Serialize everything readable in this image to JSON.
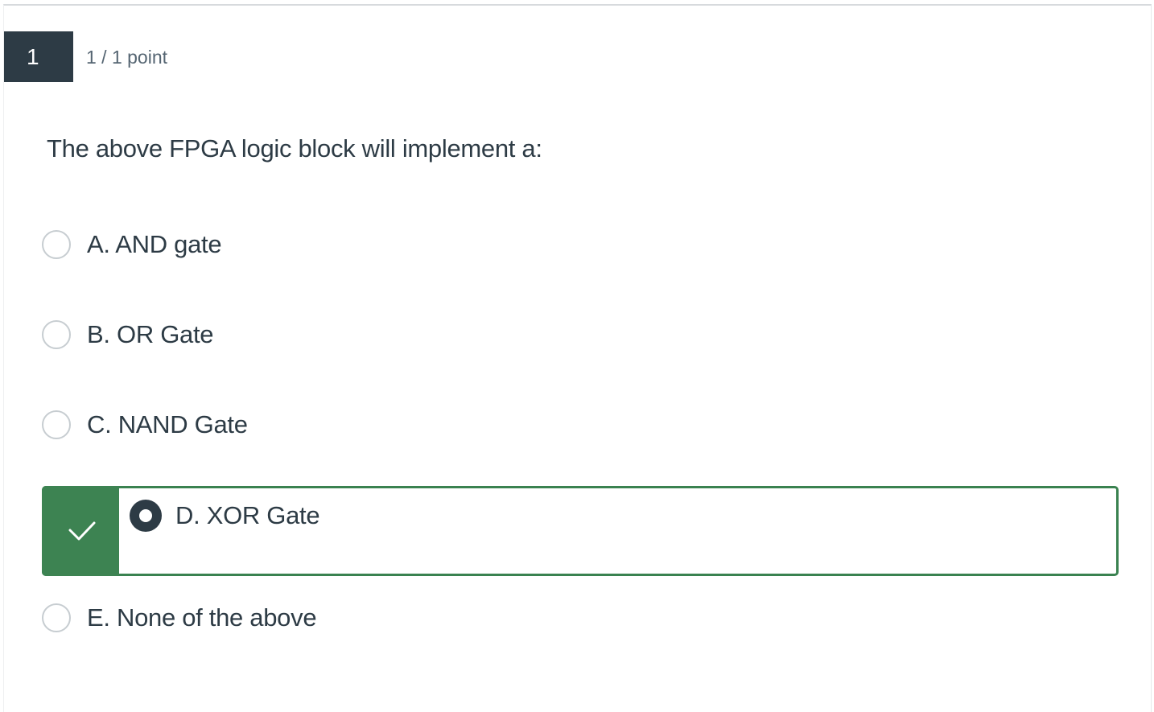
{
  "question": {
    "number": "1",
    "points": "1 / 1 point",
    "prompt": "The above FPGA logic block will implement a:"
  },
  "options": [
    {
      "label": "A. AND gate",
      "selected": false,
      "correct": false
    },
    {
      "label": "B. OR Gate",
      "selected": false,
      "correct": false
    },
    {
      "label": "C. NAND Gate",
      "selected": false,
      "correct": false
    },
    {
      "label": "D. XOR Gate",
      "selected": true,
      "correct": true
    },
    {
      "label": "E. None of the above",
      "selected": false,
      "correct": false
    }
  ],
  "icons": {
    "correct_marker": "checkmark-icon"
  },
  "colors": {
    "question_number_bg": "#2d3b45",
    "correct_green": "#3d8352",
    "text": "#2d3b45",
    "muted_text": "#556572"
  }
}
